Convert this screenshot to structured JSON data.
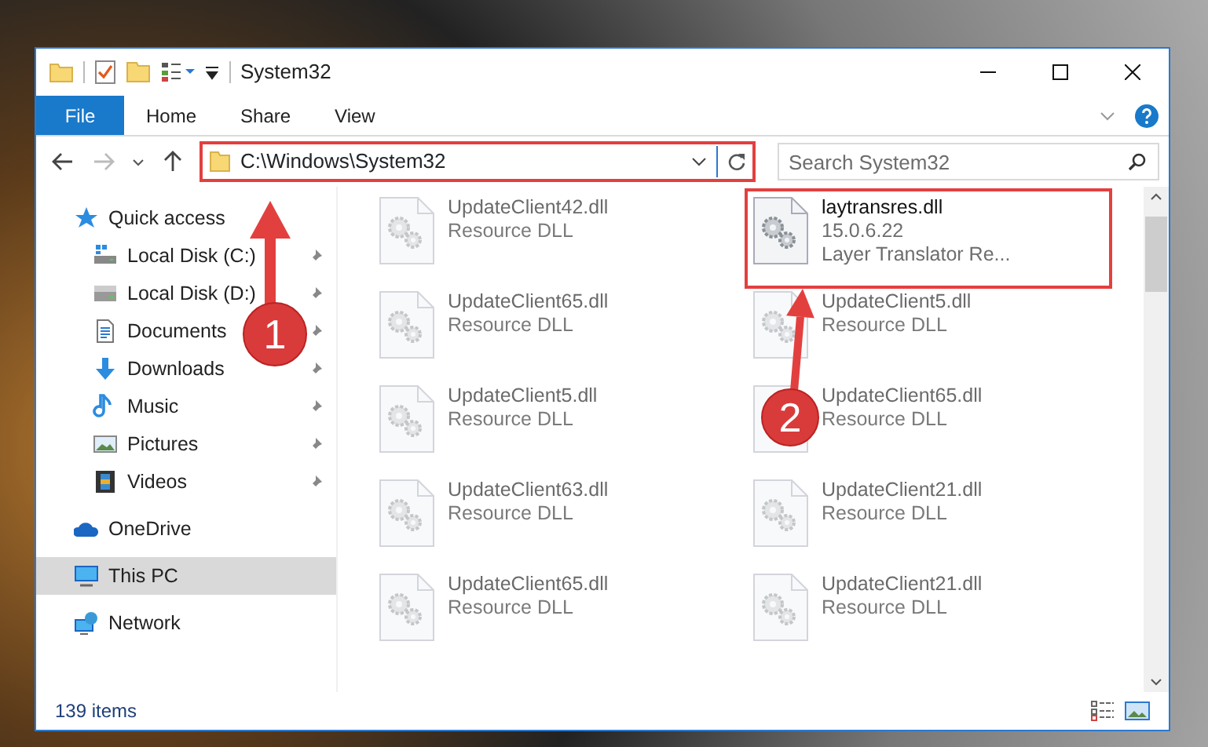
{
  "window": {
    "title": "System32"
  },
  "ribbon_tabs": [
    {
      "label": "File",
      "selected": true
    },
    {
      "label": "Home",
      "selected": false
    },
    {
      "label": "Share",
      "selected": false
    },
    {
      "label": "View",
      "selected": false
    }
  ],
  "address": {
    "path": "C:\\Windows\\System32"
  },
  "search": {
    "placeholder": "Search System32"
  },
  "sidebar": {
    "items": [
      {
        "label": "Quick access",
        "kind": "star",
        "selected": false,
        "children": [
          {
            "label": "Local Disk (C:)",
            "kind": "sysdrive",
            "pinned": true
          },
          {
            "label": "Local Disk (D:)",
            "kind": "drive",
            "pinned": true
          },
          {
            "label": "Documents",
            "kind": "document",
            "pinned": true
          },
          {
            "label": "Downloads",
            "kind": "download",
            "pinned": true
          },
          {
            "label": "Music",
            "kind": "music",
            "pinned": true
          },
          {
            "label": "Pictures",
            "kind": "picture",
            "pinned": true
          },
          {
            "label": "Videos",
            "kind": "video",
            "pinned": true
          }
        ]
      },
      {
        "label": "OneDrive",
        "kind": "cloud",
        "selected": false
      },
      {
        "label": "This PC",
        "kind": "pc",
        "selected": true
      },
      {
        "label": "Network",
        "kind": "network",
        "selected": false
      }
    ]
  },
  "files": [
    {
      "name": "UpdateClient42.dll",
      "details": [
        "Resource DLL"
      ],
      "blurred": true
    },
    {
      "name": "laytransres.dll",
      "details": [
        "15.0.6.22",
        "Layer Translator Re..."
      ],
      "blurred": false
    },
    {
      "name": "UpdateClient65.dll",
      "details": [
        "Resource DLL"
      ],
      "blurred": true
    },
    {
      "name": "UpdateClient5.dll",
      "details": [
        "Resource DLL"
      ],
      "blurred": true
    },
    {
      "name": "UpdateClient5.dll",
      "details": [
        "Resource DLL"
      ],
      "blurred": true
    },
    {
      "name": "UpdateClient65.dll",
      "details": [
        "Resource DLL"
      ],
      "blurred": true
    },
    {
      "name": "UpdateClient63.dll",
      "details": [
        "Resource DLL"
      ],
      "blurred": true
    },
    {
      "name": "UpdateClient21.dll",
      "details": [
        "Resource DLL"
      ],
      "blurred": true
    },
    {
      "name": "UpdateClient65.dll",
      "details": [
        "Resource DLL"
      ],
      "blurred": true
    },
    {
      "name": "UpdateClient21.dll",
      "details": [
        "Resource DLL"
      ],
      "blurred": true
    }
  ],
  "status_bar": {
    "item_count": "139 items"
  },
  "annotations": [
    {
      "label": "1"
    },
    {
      "label": "2"
    }
  ]
}
